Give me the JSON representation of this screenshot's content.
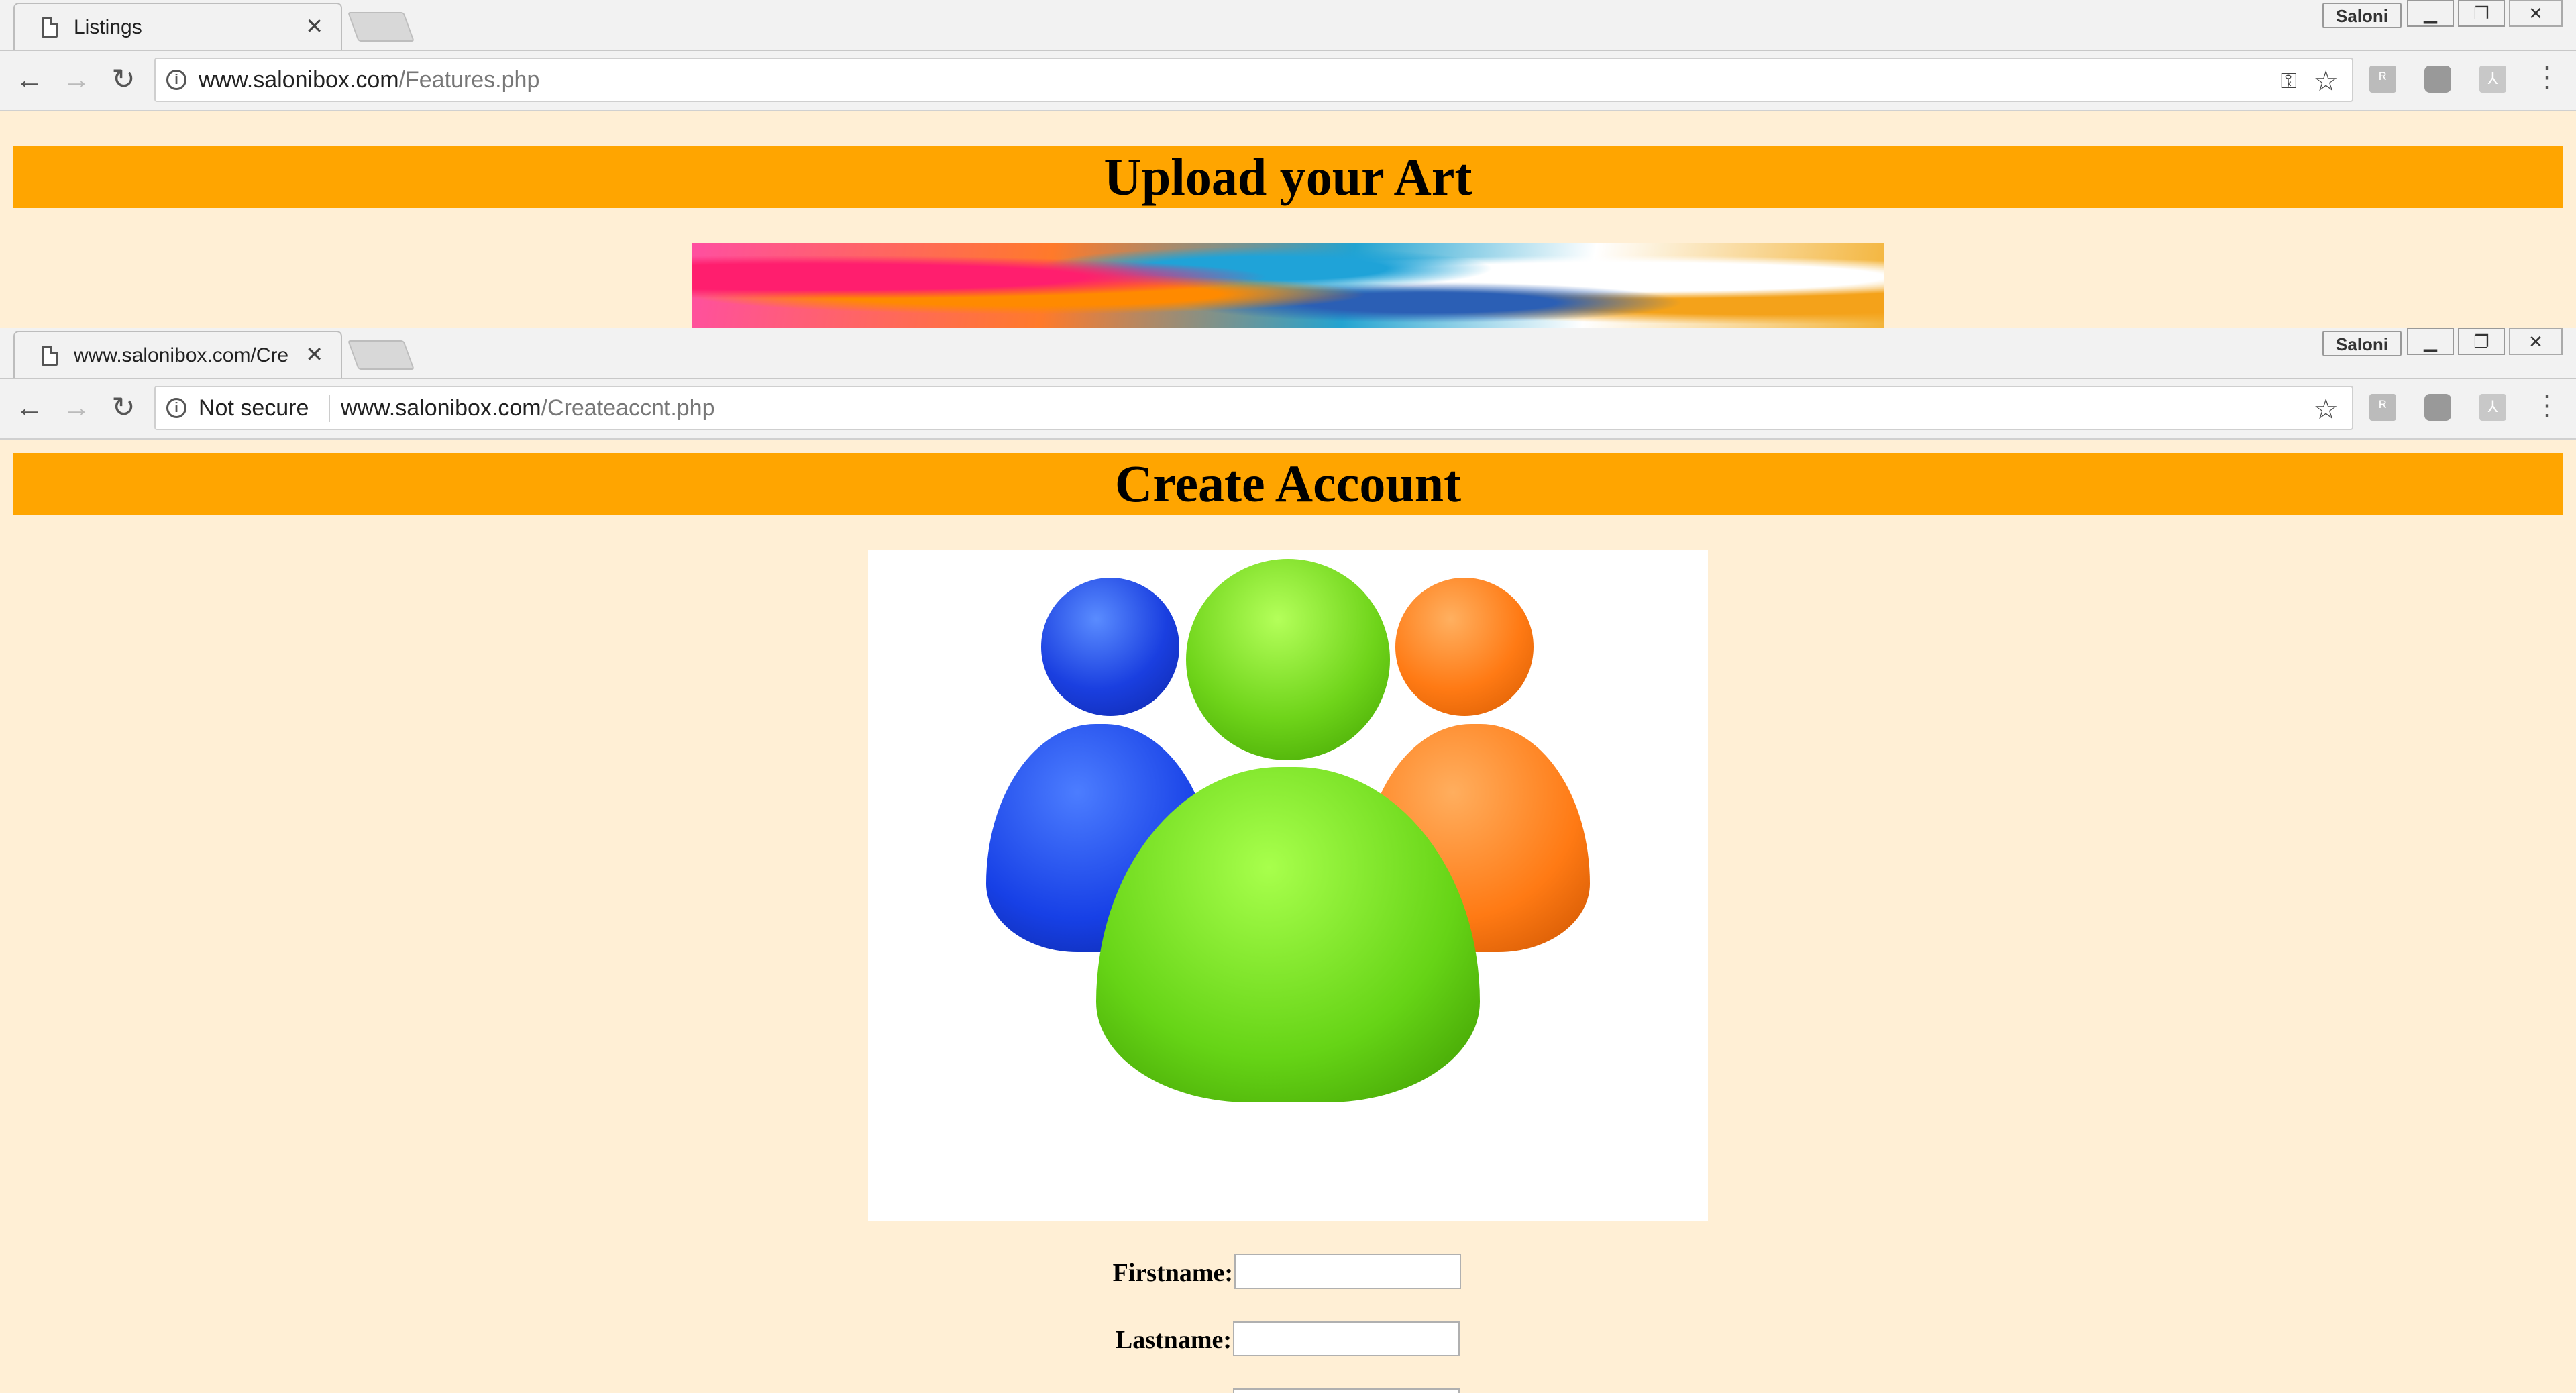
{
  "window_back": {
    "tab_title": "Listings",
    "url_host": "www.salonibox.com",
    "url_path": "/Features.php",
    "page_heading": "Upload your Art"
  },
  "window_front": {
    "tab_title": "www.salonibox.com/Cre",
    "security_label": "Not secure",
    "url_host": "www.salonibox.com",
    "url_path": "/Createaccnt.php",
    "page_heading": "Create Account",
    "form": {
      "firstname_label": "Firstname:",
      "firstname_value": "",
      "lastname_label": "Lastname:",
      "lastname_value": ""
    }
  },
  "browser": {
    "profile_name": "Saloni",
    "icons": {
      "back": "back-arrow-icon",
      "forward": "forward-arrow-icon",
      "reload": "reload-icon",
      "star": "bookmark-star-icon",
      "menu": "kebab-menu-icon"
    }
  },
  "colors": {
    "page_bg": "#ffefd5",
    "header_bg": "#ffa500"
  }
}
